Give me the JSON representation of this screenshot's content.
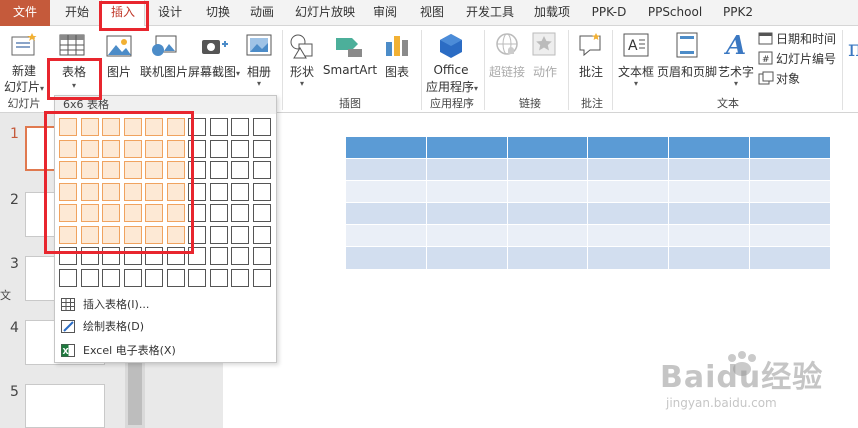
{
  "tabs": [
    {
      "label": "文件"
    },
    {
      "label": "开始"
    },
    {
      "label": "插入"
    },
    {
      "label": "设计"
    },
    {
      "label": "切换"
    },
    {
      "label": "动画"
    },
    {
      "label": "幻灯片放映"
    },
    {
      "label": "审阅"
    },
    {
      "label": "视图"
    },
    {
      "label": "开发工具"
    },
    {
      "label": "加载项"
    },
    {
      "label": "PPK-D"
    },
    {
      "label": "PPSchool"
    },
    {
      "label": "PPK2"
    }
  ],
  "ribbon": {
    "new_slide_line1": "新建",
    "new_slide_line2": "幻灯片",
    "table": "表格",
    "picture": "图片",
    "online_picture": "联机图片",
    "screenshot": "屏幕截图",
    "album": "相册",
    "shapes": "形状",
    "smartart": "SmartArt",
    "chart": "图表",
    "office_line1": "Office",
    "office_line2": "应用程序",
    "hyperlink": "超链接",
    "action": "动作",
    "comment": "批注",
    "textbox": "文本框",
    "header_footer": "页眉和页脚",
    "wordart": "艺术字",
    "datetime": "日期和时间",
    "slide_number": "幻灯片编号",
    "object": "对象",
    "groups": {
      "slides": "幻灯片",
      "illustrations": "插图",
      "apps": "应用程序",
      "links": "链接",
      "comments": "批注",
      "text": "文本"
    }
  },
  "dropdown": {
    "header": "6x6 表格",
    "insert_table": "插入表格(I)...",
    "draw_table": "绘制表格(D)",
    "excel_table": "Excel 电子表格(X)"
  },
  "slides": [
    {
      "number": "1"
    },
    {
      "number": "2"
    },
    {
      "number": "3"
    },
    {
      "number": "4"
    },
    {
      "number": "5"
    }
  ],
  "side_text": "文",
  "watermark": {
    "line1": "Baidu经验",
    "line2": "jingyan.baidu.com"
  },
  "colors": {
    "accent_red": "#e8262e",
    "file_tab": "#c55a3b",
    "table_header": "#5b9bd5",
    "grid_selected": "#f0a35f"
  }
}
